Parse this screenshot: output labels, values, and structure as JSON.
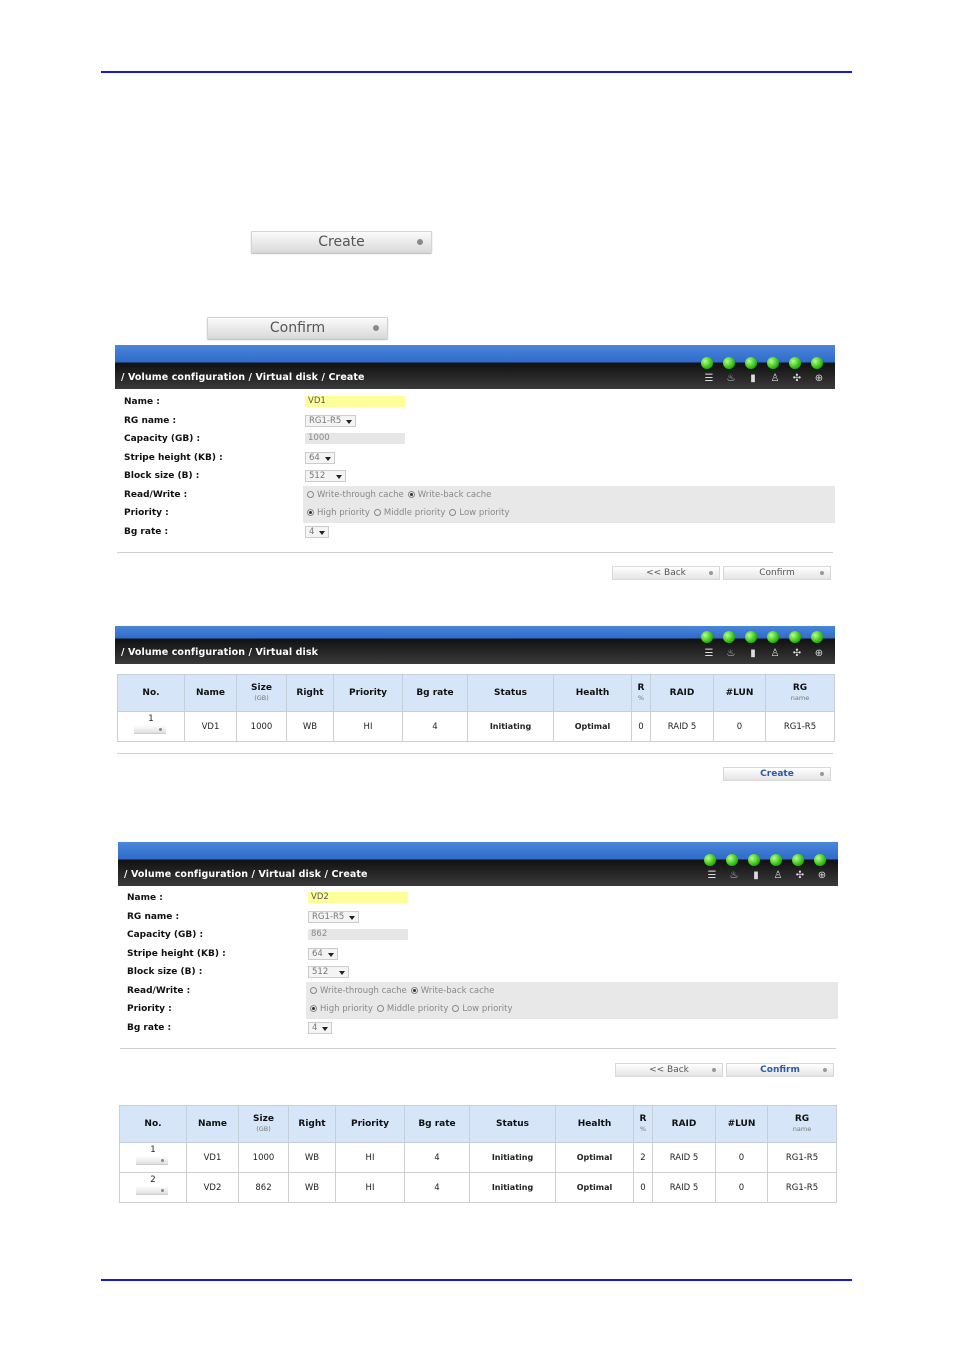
{
  "buttons": {
    "create": "Create",
    "confirm": "Confirm"
  },
  "panel1": {
    "breadcrumb": "/ Volume configuration / Virtual disk / Create",
    "form": {
      "name_label": "Name :",
      "name_value": "VD1",
      "rg_label": "RG name :",
      "rg_value": "RG1-R5",
      "capacity_label": "Capacity (GB) :",
      "capacity_value": "1000",
      "stripe_label": "Stripe height (KB) :",
      "stripe_value": "64",
      "block_label": "Block size (B) :",
      "block_value": "512",
      "rw_label": "Read/Write :",
      "priority_label": "Priority :",
      "bg_label": "Bg rate :",
      "bg_value": "4"
    },
    "back": "<< Back",
    "confirm": "Confirm"
  },
  "options": {
    "write_through": "Write-through cache",
    "write_back": "Write-back cache",
    "high": "High priority",
    "middle": "Middle priority",
    "low": "Low priority"
  },
  "panel2": {
    "breadcrumb": "/ Volume configuration / Virtual disk",
    "create": "Create"
  },
  "panel3": {
    "breadcrumb": "/ Volume configuration / Virtual disk / Create",
    "form": {
      "name_label": "Name :",
      "name_value": "VD2",
      "rg_label": "RG name :",
      "rg_value": "RG1-R5",
      "capacity_label": "Capacity (GB) :",
      "capacity_value": "862",
      "stripe_label": "Stripe height (KB) :",
      "stripe_value": "64",
      "block_label": "Block size (B) :",
      "block_value": "512",
      "rw_label": "Read/Write :",
      "priority_label": "Priority :",
      "bg_label": "Bg rate :",
      "bg_value": "4"
    },
    "back": "<< Back",
    "confirm": "Confirm"
  },
  "table": {
    "headers": {
      "no": "No.",
      "name": "Name",
      "size": "Size",
      "size_unit": "(GB)",
      "right": "Right",
      "priority": "Priority",
      "bg": "Bg rate",
      "status": "Status",
      "health": "Health",
      "r": "R",
      "r_unit": "%",
      "raid": "RAID",
      "lun": "#LUN",
      "rg": "RG",
      "rg_unit": "name"
    },
    "rows1": [
      {
        "no": "1",
        "name": "VD1",
        "size": "1000",
        "right": "WB",
        "priority": "HI",
        "bg": "4",
        "status": "Initiating",
        "health": "Optimal",
        "r": "0",
        "raid": "RAID 5",
        "lun": "0",
        "rg": "RG1-R5"
      }
    ],
    "rows2": [
      {
        "no": "1",
        "name": "VD1",
        "size": "1000",
        "right": "WB",
        "priority": "HI",
        "bg": "4",
        "status": "Initiating",
        "health": "Optimal",
        "r": "2",
        "raid": "RAID 5",
        "lun": "0",
        "rg": "RG1-R5"
      },
      {
        "no": "2",
        "name": "VD2",
        "size": "862",
        "right": "WB",
        "priority": "HI",
        "bg": "4",
        "status": "Initiating",
        "health": "Optimal",
        "r": "0",
        "raid": "RAID 5",
        "lun": "0",
        "rg": "RG1-R5"
      }
    ]
  }
}
